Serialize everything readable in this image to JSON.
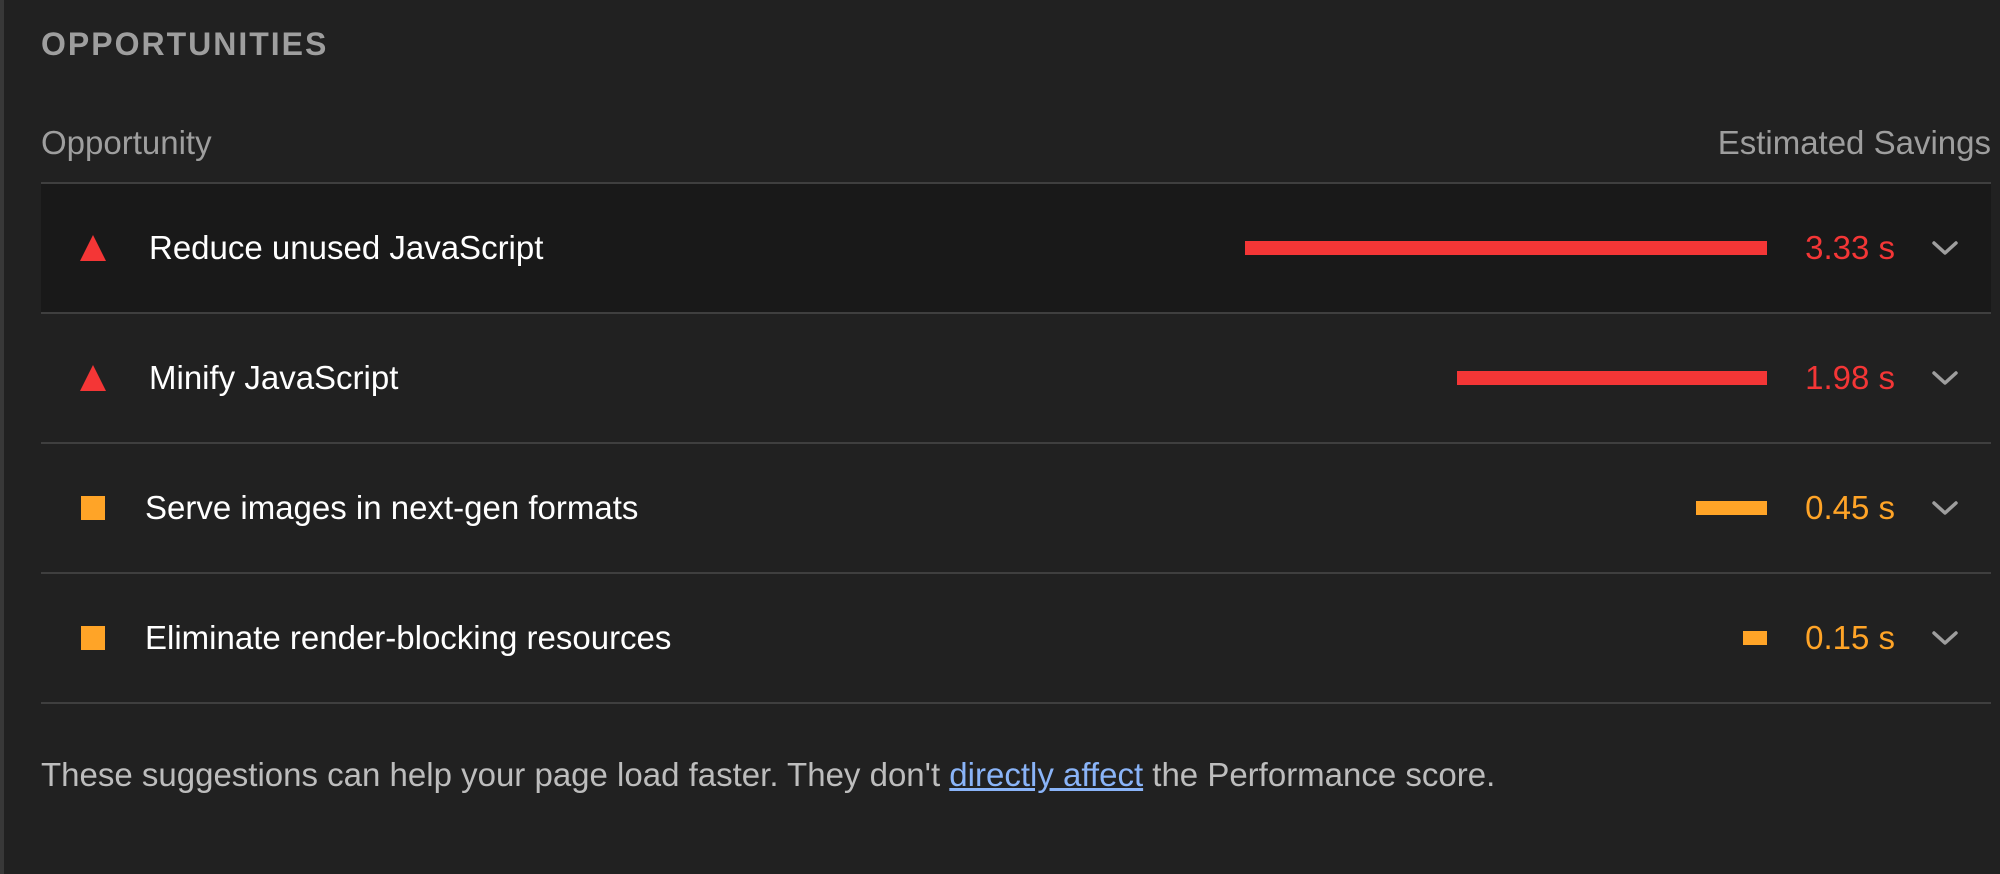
{
  "section": {
    "title": "OPPORTUNITIES"
  },
  "table_header": {
    "left": "Opportunity",
    "right": "Estimated Savings"
  },
  "colors": {
    "fail": "#f43636",
    "average": "#ffa427",
    "background": "#212121",
    "link": "#8ab4f8"
  },
  "audits": [
    {
      "icon": "fail-triangle-icon",
      "title": "Reduce unused JavaScript",
      "savings": "3.33 s",
      "savings_seconds": 3.33,
      "status": "fail"
    },
    {
      "icon": "fail-triangle-icon",
      "title": "Minify JavaScript",
      "savings": "1.98 s",
      "savings_seconds": 1.98,
      "status": "fail"
    },
    {
      "icon": "average-square-icon",
      "title": "Serve images in next-gen formats",
      "savings": "0.45 s",
      "savings_seconds": 0.45,
      "status": "average"
    },
    {
      "icon": "average-square-icon",
      "title": "Eliminate render-blocking resources",
      "savings": "0.15 s",
      "savings_seconds": 0.15,
      "status": "average"
    }
  ],
  "footer": {
    "before_link": "These suggestions can help your page load faster. They don't ",
    "link_text": "directly affect",
    "after_link": " the Performance score."
  }
}
